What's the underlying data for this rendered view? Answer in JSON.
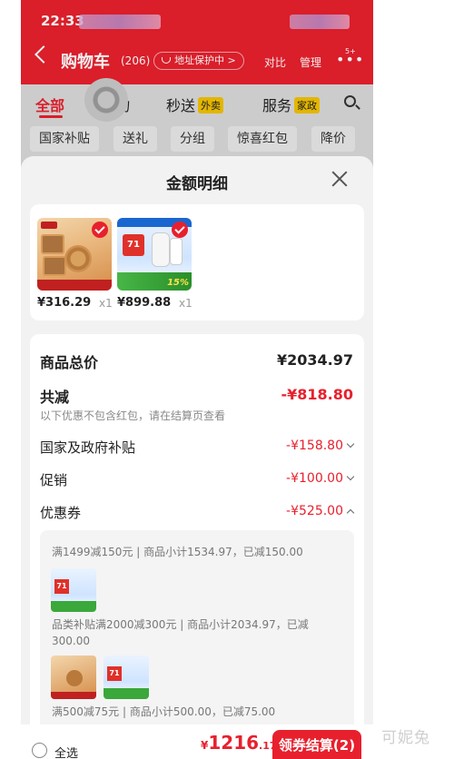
{
  "status": {
    "time": "22:33"
  },
  "nav": {
    "title": "购物车",
    "count": "(206)",
    "address": "地址保护中 >",
    "compare": "对比",
    "manage": "管理",
    "more": "•••",
    "badge": "5+"
  },
  "tabs": [
    {
      "label": "全部"
    },
    {
      "label": "购物"
    },
    {
      "label": "秒送",
      "tag": "外卖"
    },
    {
      "label": "服务",
      "tag": "家政"
    }
  ],
  "chips": [
    "国家补贴",
    "送礼",
    "分组",
    "惊喜红包",
    "降价"
  ],
  "sheet": {
    "title": "金额明细",
    "products": [
      {
        "price": "¥316.29",
        "qty": "x1",
        "image": "mooncake-gift-box"
      },
      {
        "price": "¥899.88",
        "qty": "x1",
        "image": "air-purifier"
      }
    ],
    "detail": {
      "total_label": "商品总价",
      "total_value": "¥2034.97",
      "reduce_label": "共减",
      "reduce_value": "-¥818.80",
      "reduce_note": "以下优惠不包含红包，请在结算页查看",
      "subsidy_label": "国家及政府补贴",
      "subsidy_value": "-¥158.80",
      "promo_label": "促销",
      "promo_value": "-¥100.00",
      "coupon_label": "优惠券",
      "coupon_value": "-¥525.00",
      "coupons": [
        {
          "text": "满1499减150元 | 商品小计1534.97，已减150.00"
        },
        {
          "text": "品类补贴满2000减300元 | 商品小计2034.97，已减",
          "text2": "300.00"
        },
        {
          "text": "满500减75元 | 商品小计500.00，已减75.00"
        }
      ]
    }
  },
  "bottom": {
    "select_all": "全选",
    "price_cur": "¥",
    "price_int": "1216",
    "price_dec": ".17",
    "checkout": "领券结算(2)"
  },
  "watermark": "可妮兔"
}
